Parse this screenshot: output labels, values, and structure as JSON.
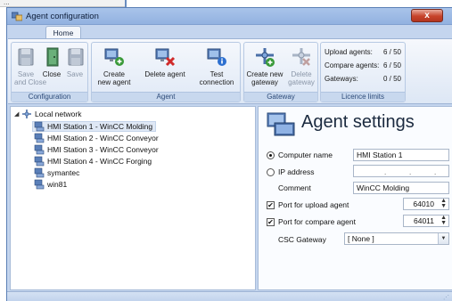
{
  "window": {
    "title": "Agent configuration",
    "close_glyph": "x"
  },
  "background": {
    "dots": "..."
  },
  "ribbon": {
    "tab": "Home",
    "groups": {
      "configuration": {
        "label": "Configuration",
        "save_and_close": [
          "Save",
          "and Close"
        ],
        "close": "Close",
        "save": "Save"
      },
      "agent": {
        "label": "Agent",
        "create": [
          "Create",
          "new agent"
        ],
        "delete": "Delete agent",
        "test": [
          "Test",
          "connection"
        ]
      },
      "gateway": {
        "label": "Gateway",
        "create": [
          "Create new",
          "gateway"
        ],
        "delete": [
          "Delete",
          "gateway"
        ]
      },
      "licence": {
        "label": "Licence limits",
        "upload_label": "Upload agents:",
        "upload_value": "6 / 50",
        "compare_label": "Compare agents:",
        "compare_value": "6 / 50",
        "gateways_label": "Gateways:",
        "gateways_value": "0 / 50"
      }
    }
  },
  "tree": {
    "expander": "◢",
    "root": "Local network",
    "items": [
      "HMI Station 1 - WinCC Molding",
      "HMI Station 2 - WinCC Conveyor",
      "HMI Station 3 - WinCC Conveyor",
      "HMI Station 4 - WinCC Forging",
      "symantec",
      "win81"
    ],
    "selected_index": 0
  },
  "settings": {
    "title": "Agent settings",
    "computer_name_label": "Computer name",
    "computer_name_value": "HMI Station 1",
    "ip_label": "IP address",
    "ip_dot": ".",
    "comment_label": "Comment",
    "comment_value": "WinCC Molding",
    "upload_port_label": "Port for upload agent",
    "upload_port_value": "64010",
    "compare_port_label": "Port for compare agent",
    "compare_port_value": "64011",
    "gateway_label": "CSC Gateway",
    "gateway_value": "[ None ]",
    "check_glyph": "✔",
    "spin_glyph": "▲▼",
    "dropdown_glyph": "▼"
  },
  "statusbar": {
    "grip": "⋰"
  },
  "colors": {
    "accent": "#5a7fb5",
    "ribbon_label": "#2c4a78",
    "close": "#c7432b"
  }
}
